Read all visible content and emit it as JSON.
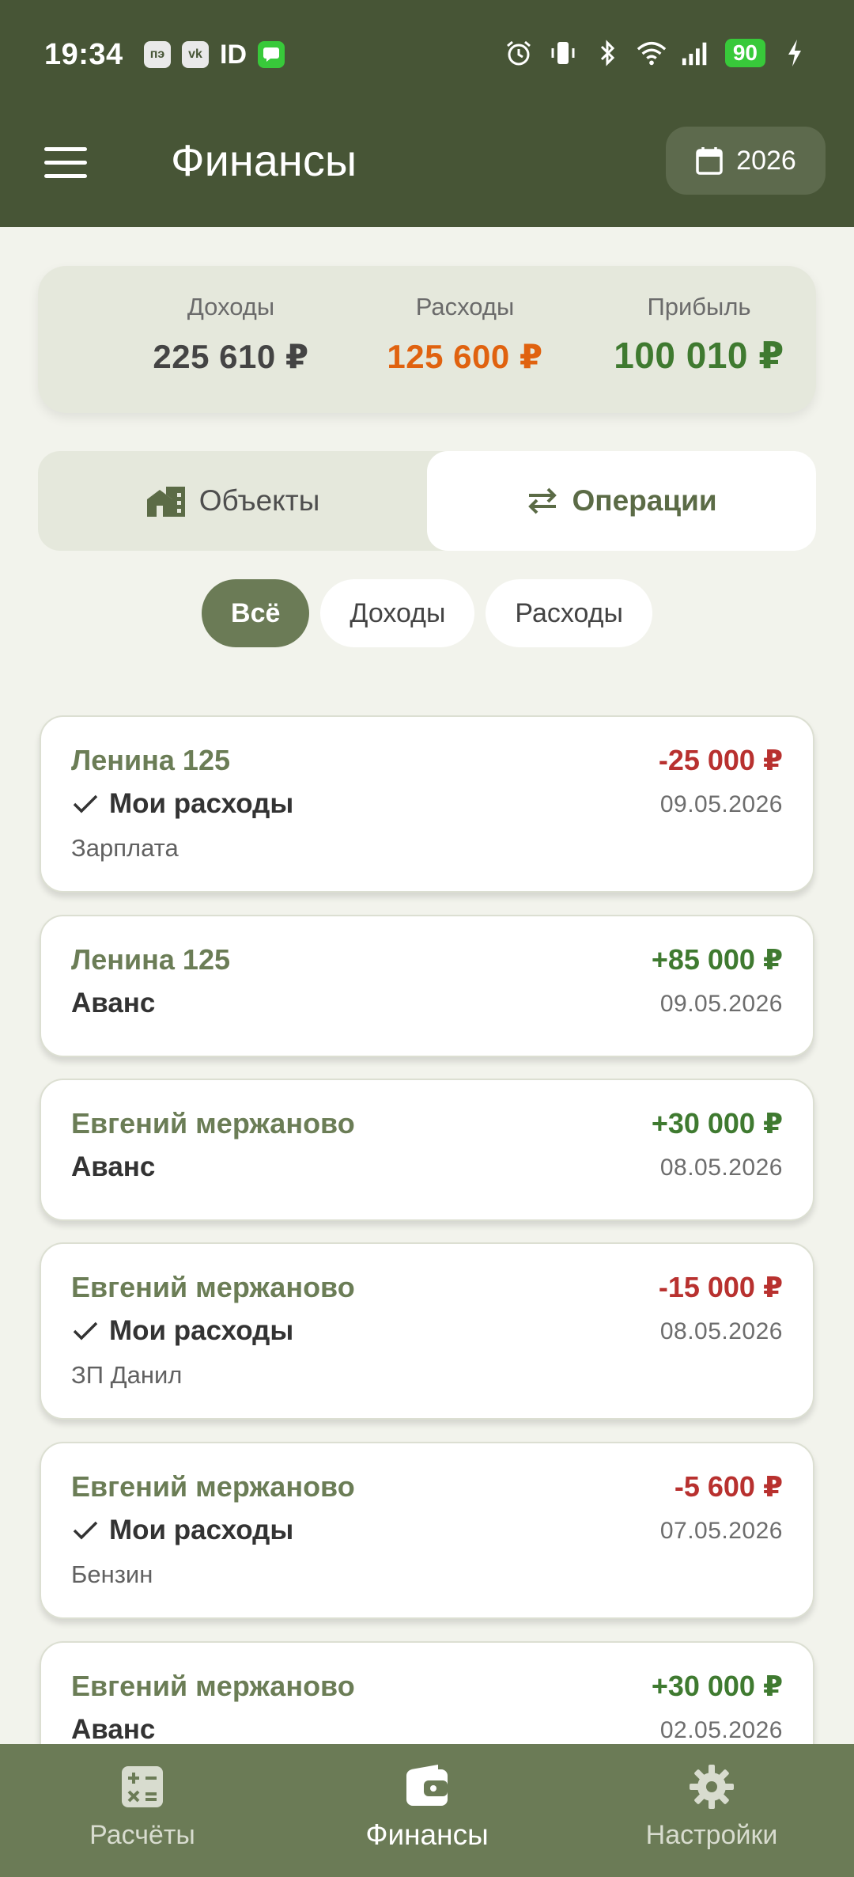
{
  "status_bar": {
    "time": "19:34",
    "id_badge": "ID",
    "battery": "90"
  },
  "app_bar": {
    "title": "Финансы",
    "year": "2026"
  },
  "summary": {
    "income_label": "Доходы",
    "income_value": "225 610 ₽",
    "expenses_label": "Расходы",
    "expenses_value": "125 600 ₽",
    "profit_label": "Прибыль",
    "profit_value": "100 010 ₽"
  },
  "tabs": {
    "objects": "Объекты",
    "operations": "Операции"
  },
  "filters": [
    "Всё",
    "Доходы",
    "Расходы"
  ],
  "operations": [
    {
      "place": "Ленина 125",
      "amount": "-25 000 ₽",
      "date": "09.05.2026",
      "category": "Мои расходы",
      "note": "Зарплата",
      "type": "expense"
    },
    {
      "place": "Ленина 125",
      "amount": "+85 000 ₽",
      "date": "09.05.2026",
      "category": "Аванс",
      "note": "",
      "type": "income"
    },
    {
      "place": "Евгений мержаново",
      "amount": "+30 000 ₽",
      "date": "08.05.2026",
      "category": "Аванс",
      "note": "",
      "type": "income"
    },
    {
      "place": "Евгений мержаново",
      "amount": "-15 000 ₽",
      "date": "08.05.2026",
      "category": "Мои расходы",
      "note": "ЗП Данил",
      "type": "expense"
    },
    {
      "place": "Евгений мержаново",
      "amount": "-5 600 ₽",
      "date": "07.05.2026",
      "category": "Мои расходы",
      "note": "Бензин",
      "type": "expense"
    },
    {
      "place": "Евгений мержаново",
      "amount": "+30 000 ₽",
      "date": "02.05.2026",
      "category": "Аванс",
      "note": "",
      "type": "income"
    }
  ],
  "bottom_nav": {
    "calc": "Расчёты",
    "finance": "Финансы",
    "settings": "Настройки"
  },
  "colors": {
    "primary": "#475536",
    "accent": "#6b7b56",
    "negative": "#b8312f",
    "positive": "#3f7a30",
    "expense_summary": "#e0620f",
    "background": "#f2f3ec"
  }
}
